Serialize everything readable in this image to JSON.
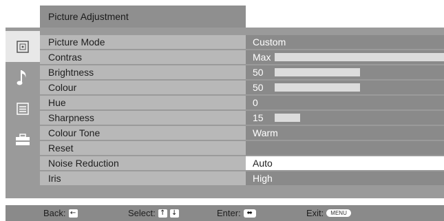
{
  "header": {
    "title": "Picture Adjustment"
  },
  "tabs": [
    {
      "icon": "picture-icon",
      "selected": true
    },
    {
      "icon": "music-note-icon",
      "selected": false
    },
    {
      "icon": "settings-list-icon",
      "selected": false
    },
    {
      "icon": "setup-icon",
      "selected": false
    }
  ],
  "menu": {
    "rows": [
      {
        "label": "Picture Mode",
        "value": "Custom"
      },
      {
        "label": "Contras",
        "value": "Max",
        "level": 1.0
      },
      {
        "label": "Brightness",
        "value": "50",
        "level": 0.5
      },
      {
        "label": "Colour",
        "value": "50",
        "level": 0.5
      },
      {
        "label": "Hue",
        "value": "0"
      },
      {
        "label": "Sharpness",
        "value": "15",
        "level": 0.15
      },
      {
        "label": "Colour Tone",
        "value": "Warm"
      },
      {
        "label": "Reset",
        "value": ""
      },
      {
        "label": "Noise Reduction",
        "value": "Auto",
        "highlighted": true
      },
      {
        "label": "Iris",
        "value": "High"
      }
    ]
  },
  "footer": {
    "back_label": "Back:",
    "select_label": "Select:",
    "enter_label": "Enter:",
    "exit_label": "Exit:",
    "menu_button": "MENU"
  },
  "colors": {
    "highlight_background": "#ffffff",
    "panel_background": "#9a9a9a",
    "label_background": "#b8b8b8",
    "value_background": "#8a8a8a"
  }
}
